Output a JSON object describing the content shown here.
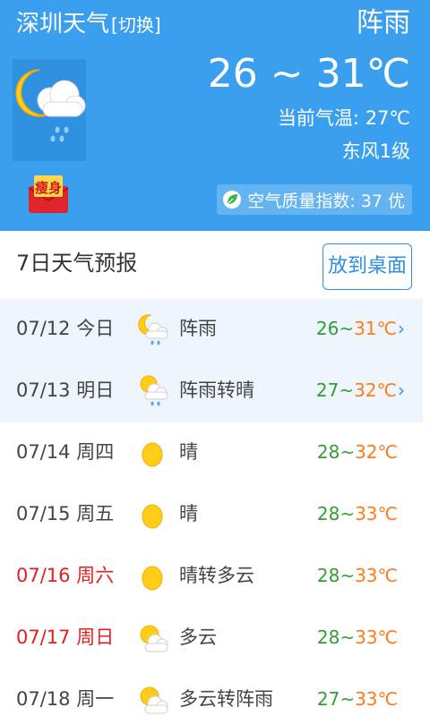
{
  "header": {
    "city": "深圳天气",
    "switch_label": "[切换]",
    "condition": "阵雨",
    "temp_range": "26 ~ 31℃",
    "current_temp": "当前气温: 27℃",
    "wind": "东风1级",
    "aqi": "空气质量指数: 37 优",
    "promo_label": "瘦身",
    "colors": {
      "header_bg": "#3a9fef",
      "aqi_bg": "#64b4f2"
    }
  },
  "forecast": {
    "title": "7日天气预报",
    "desk_button": "放到桌面",
    "days": [
      {
        "date": "07/12 今日",
        "weekend": false,
        "icon": "moon-cloud-rain-icon",
        "desc": "阵雨",
        "lo": "26",
        "hi": "31℃",
        "arrow": true,
        "highlight": true
      },
      {
        "date": "07/13 明日",
        "weekend": false,
        "icon": "sun-cloud-rain-icon",
        "desc": "阵雨转晴",
        "lo": "27",
        "hi": "32℃",
        "arrow": true,
        "highlight": true
      },
      {
        "date": "07/14 周四",
        "weekend": false,
        "icon": "sun-icon",
        "desc": "晴",
        "lo": "28",
        "hi": "32℃",
        "arrow": false,
        "highlight": false
      },
      {
        "date": "07/15 周五",
        "weekend": false,
        "icon": "sun-icon",
        "desc": "晴",
        "lo": "28",
        "hi": "33℃",
        "arrow": false,
        "highlight": false
      },
      {
        "date": "07/16 周六",
        "weekend": true,
        "icon": "sun-icon",
        "desc": "晴转多云",
        "lo": "28",
        "hi": "33℃",
        "arrow": false,
        "highlight": false
      },
      {
        "date": "07/17 周日",
        "weekend": true,
        "icon": "sun-cloud-icon",
        "desc": "多云",
        "lo": "28",
        "hi": "33℃",
        "arrow": false,
        "highlight": false
      },
      {
        "date": "07/18 周一",
        "weekend": false,
        "icon": "sun-cloud-icon",
        "desc": "多云转阵雨",
        "lo": "27",
        "hi": "33℃",
        "arrow": false,
        "highlight": false
      }
    ],
    "colors": {
      "low": "#30a030",
      "high": "#ff7a1a",
      "weekend": "#e02020",
      "accent": "#2f8fe0"
    }
  }
}
